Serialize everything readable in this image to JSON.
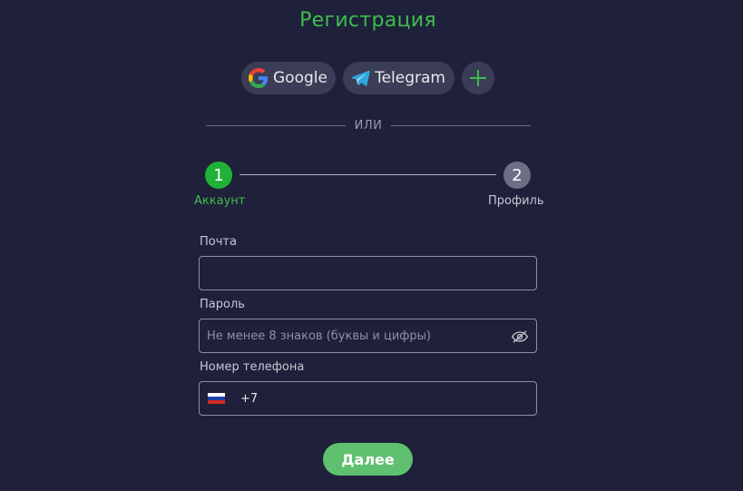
{
  "page": {
    "title": "Регистрация"
  },
  "social": {
    "google_label": "Google",
    "telegram_label": "Telegram",
    "more_icon": "plus-icon",
    "google_icon": "google-icon",
    "telegram_icon": "telegram-icon"
  },
  "divider": {
    "text": "ИЛИ"
  },
  "stepper": {
    "steps": [
      {
        "number": "1",
        "label": "Аккаунт",
        "state": "active",
        "color": "#1fb237"
      },
      {
        "number": "2",
        "label": "Профиль",
        "state": "inactive",
        "color": "#6d7085"
      }
    ]
  },
  "form": {
    "email": {
      "label": "Почта",
      "value": "",
      "placeholder": ""
    },
    "password": {
      "label": "Пароль",
      "value": "",
      "placeholder": "Не менее 8 знаков (буквы и цифры)",
      "toggle_icon": "eye-slash-icon"
    },
    "phone": {
      "label": "Номер телефона",
      "country_flag": "russia-flag-icon",
      "prefix": "+7",
      "value": ""
    }
  },
  "actions": {
    "next_label": "Далее"
  },
  "colors": {
    "background": "#1e2139",
    "accent": "#3fbd4f",
    "button_bg": "#5fc070",
    "social_bg": "#3a3d55"
  }
}
